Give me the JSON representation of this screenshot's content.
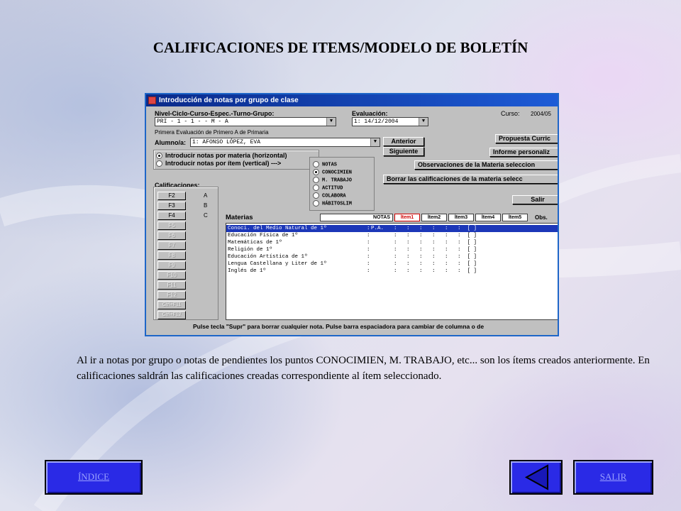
{
  "page": {
    "title": "CALIFICACIONES DE ITEMS/MODELO DE BOLETÍN",
    "description": "Al ir a notas por grupo o notas de pendientes los puntos CONOCIMIEN, M. TRABAJO, etc... son los ítems creados anteriormente. En calificaciones saldrán las calificaciones creadas correspondiente al ítem seleccionado."
  },
  "window": {
    "title": "Introducción de notas por grupo de clase",
    "nivel_label": "Nivel-Ciclo-Curso-Espec.-Turno-Grupo:",
    "nivel_value": "PRI - 1  -  1  -     -  M  -  A",
    "evaluacion_label": "Evaluación:",
    "evaluacion_value": "1: 14/12/2004",
    "curso_label": "Curso:",
    "curso_value": "2004/05",
    "subtitle": "Primera Evaluación de Primero A de Primaria",
    "alumno_label": "Alumno/a:",
    "alumno_value": "1: AFONSO LÓPEZ, EVA",
    "anterior_button": "Anterior",
    "siguiente_button": "Siguiente",
    "propuesta_button": "Propuesta Curric",
    "informe_button": "Informe personaliz",
    "observaciones_button": "Observaciones de la Materia seleccion",
    "borrar_button": "Borrar las calificaciones de la materia selecc",
    "salir_button": "Salir",
    "mode_options": [
      {
        "label": "Introducir notas por materia (horizontal)",
        "selected": true
      },
      {
        "label": "Introducir notas por ítem (vertical)  --->",
        "selected": false
      }
    ],
    "item_options": [
      {
        "label": "NOTAS",
        "selected": false
      },
      {
        "label": "CONOCIMIEN",
        "selected": true
      },
      {
        "label": "M. TRABAJO",
        "selected": false
      },
      {
        "label": "ACTITUD",
        "selected": false
      },
      {
        "label": "COLABORA",
        "selected": false
      },
      {
        "label": "HÁBITOSLIM",
        "selected": false
      }
    ],
    "calificaciones_label": "Calificaciones:",
    "function_keys": [
      {
        "key": "F2",
        "grade": "A",
        "enabled": true
      },
      {
        "key": "F3",
        "grade": "B",
        "enabled": true
      },
      {
        "key": "F4",
        "grade": "C",
        "enabled": true
      },
      {
        "key": "F5",
        "grade": "",
        "enabled": false
      },
      {
        "key": "F6",
        "grade": "",
        "enabled": false
      },
      {
        "key": "F7",
        "grade": "",
        "enabled": false
      },
      {
        "key": "F8",
        "grade": "",
        "enabled": false
      },
      {
        "key": "F9",
        "grade": "",
        "enabled": false
      },
      {
        "key": "F10",
        "grade": "",
        "enabled": false
      },
      {
        "key": "F11",
        "grade": "",
        "enabled": false
      },
      {
        "key": "F12",
        "grade": "",
        "enabled": false
      },
      {
        "key": "Ctrl+F11",
        "grade": "",
        "enabled": false
      },
      {
        "key": "Ctrl+F12",
        "grade": "",
        "enabled": false
      }
    ],
    "materias_label": "Materias",
    "columns": [
      "NOTAS",
      "Ítem1",
      "Ítem2",
      "Ítem3",
      "Ítem4",
      "Ítem5",
      "Obs."
    ],
    "subjects": [
      "Conoci. del Medio Natural de 1º",
      "Educación Física de 1º",
      "Matemáticas de 1º",
      "Religión de 1º",
      "Educación Artística de 1º",
      "Lengua Castellana y Liter de 1º",
      "Inglés de 1º"
    ],
    "first_row_nota": "P.A.",
    "status_bar": "Pulse tecla \"Supr\" para borrar cualquier nota. Pulse barra espaciadora para cambiar de columna o de"
  },
  "nav": {
    "indice": "ÍNDICE",
    "salir": "SALIR"
  },
  "colors": {
    "window_border": "#1e66c8",
    "nav_button": "#2a2ae6",
    "selected_row": "#1c37b8"
  }
}
